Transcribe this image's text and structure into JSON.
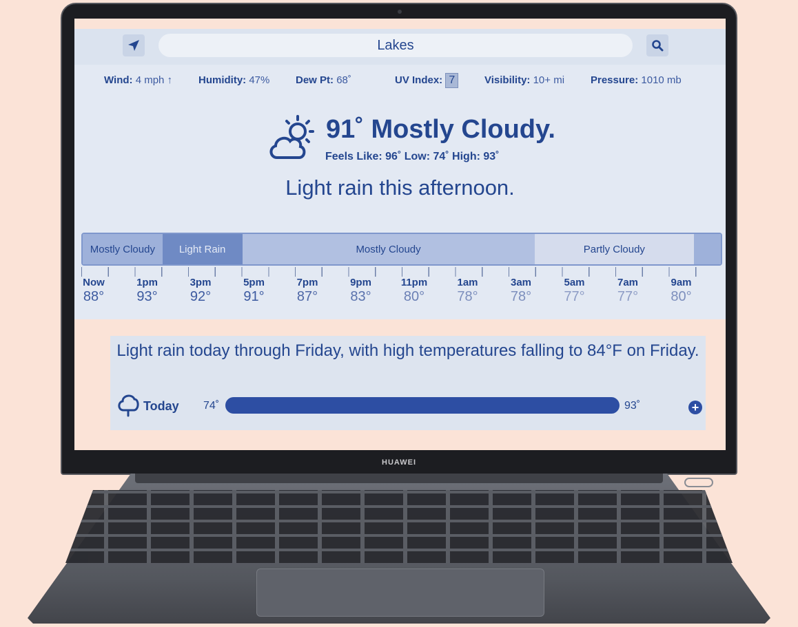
{
  "device": {
    "brand": "HUAWEI"
  },
  "search": {
    "value": "Lakes"
  },
  "stats": [
    {
      "label": "Wind:",
      "value": "4 mph ↑"
    },
    {
      "label": "Humidity:",
      "value": "47%"
    },
    {
      "label": "Dew Pt:",
      "value": "68˚"
    },
    {
      "label": "UV Index:",
      "value": "7"
    },
    {
      "label": "Visibility:",
      "value": "10+ mi"
    },
    {
      "label": "Pressure:",
      "value": "1010 mb"
    }
  ],
  "current": {
    "headline": "91˚ Mostly Cloudy.",
    "feels": "Feels Like: 96˚ Low: 74˚ High: 93˚",
    "summary": "Light rain this afternoon.",
    "icon": "partly-cloudy-sun-icon"
  },
  "timeline": [
    {
      "label": "Mostly Cloudy",
      "fraction": 0.125,
      "color": "#9eb1da"
    },
    {
      "label": "Light Rain",
      "fraction": 0.125,
      "color": "#6f8ac4"
    },
    {
      "label": "Mostly Cloudy",
      "fraction": 0.458,
      "color": "#b1c0e1"
    },
    {
      "label": "Partly Cloudy",
      "fraction": 0.25,
      "color": "#d5dced"
    },
    {
      "label": "",
      "fraction": 0.042,
      "color": "#9eb1da"
    }
  ],
  "hours": [
    {
      "time": "Now",
      "temp": "88°",
      "color": "#3c5aa0"
    },
    {
      "time": "1pm",
      "temp": "93°",
      "color": "#3c5aa0"
    },
    {
      "time": "3pm",
      "temp": "92°",
      "color": "#3c5aa0"
    },
    {
      "time": "5pm",
      "temp": "91°",
      "color": "#3c5aa0"
    },
    {
      "time": "7pm",
      "temp": "87°",
      "color": "#4e67a6"
    },
    {
      "time": "9pm",
      "temp": "83°",
      "color": "#5a72ad"
    },
    {
      "time": "11pm",
      "temp": "80°",
      "color": "#6b80b5"
    },
    {
      "time": "1am",
      "temp": "78°",
      "color": "#7d8fbd"
    },
    {
      "time": "3am",
      "temp": "78°",
      "color": "#7d8fbd"
    },
    {
      "time": "5am",
      "temp": "77°",
      "color": "#8d9cc5"
    },
    {
      "time": "7am",
      "temp": "77°",
      "color": "#8d9cc5"
    },
    {
      "time": "9am",
      "temp": "80°",
      "color": "#7d8fbd"
    }
  ],
  "forecast": {
    "text": "Light rain today through Friday, with high temperatures falling to 84°F on Friday.",
    "today": {
      "name": "Today",
      "low": "74˚",
      "high": "93˚",
      "range_fraction": 1.0,
      "icon": "rain-cloud-icon"
    }
  },
  "colors": {
    "accent": "#24468f",
    "bar": "#2d4ea3",
    "page_bg": "#fbe3d7"
  }
}
